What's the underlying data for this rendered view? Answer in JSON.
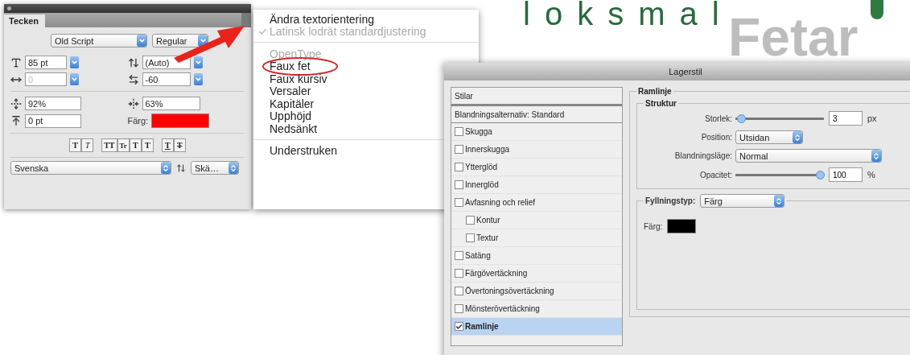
{
  "backdrop": {
    "headline": "loksmal",
    "subheadline": "Fetar"
  },
  "character_panel": {
    "tab": "Tecken",
    "font_family": "Old Script",
    "font_style": "Regular",
    "font_size": "85 pt",
    "leading": "(Auto)",
    "kerning": "0",
    "kerning_disabled": true,
    "tracking": "-60",
    "vertical_scale": "92%",
    "horizontal_scale": "63%",
    "baseline_shift": "0 pt",
    "color_label": "Färg:",
    "style_buttons": [
      {
        "label": "T",
        "kind": "bold"
      },
      {
        "label": "T",
        "kind": "italic"
      },
      {
        "label": "TT",
        "kind": "caps"
      },
      {
        "label": "Tr",
        "kind": "smallcaps"
      },
      {
        "label": "T",
        "kind": "super"
      },
      {
        "label": "T",
        "kind": "sub"
      },
      {
        "label": "T",
        "kind": "underline"
      },
      {
        "label": "T",
        "kind": "strike"
      }
    ],
    "language": "Svenska",
    "antialias": "Skä…"
  },
  "menu": {
    "items": [
      {
        "kind": "item",
        "label": "Ändra textorientering",
        "checked": false,
        "disabled": false,
        "circled": false
      },
      {
        "kind": "item",
        "label": "Latinsk lodrät standardjustering",
        "checked": true,
        "disabled": true,
        "circled": false
      },
      {
        "kind": "separator"
      },
      {
        "kind": "item",
        "label": "OpenType",
        "checked": false,
        "disabled": true,
        "circled": false
      },
      {
        "kind": "item",
        "label": "Faux fet",
        "checked": false,
        "disabled": false,
        "circled": true
      },
      {
        "kind": "item",
        "label": "Faux kursiv",
        "checked": false,
        "disabled": false,
        "circled": false
      },
      {
        "kind": "item",
        "label": "Versaler",
        "checked": false,
        "disabled": false,
        "circled": false
      },
      {
        "kind": "item",
        "label": "Kapitäler",
        "checked": false,
        "disabled": false,
        "circled": false
      },
      {
        "kind": "item",
        "label": "Upphöjd",
        "checked": false,
        "disabled": false,
        "circled": false
      },
      {
        "kind": "item",
        "label": "Nedsänkt",
        "checked": false,
        "disabled": false,
        "circled": false
      },
      {
        "kind": "separator"
      },
      {
        "kind": "item",
        "label": "Understruken",
        "checked": false,
        "disabled": false,
        "circled": false
      }
    ]
  },
  "layer_style": {
    "title": "Lagerstil",
    "styles_header": "Stilar",
    "blending_header": "Blandningsalternativ: Standard",
    "effects": [
      {
        "label": "Skugga",
        "checked": false,
        "selected": false
      },
      {
        "label": "Innerskugga",
        "checked": false,
        "selected": false
      },
      {
        "label": "Ytterglöd",
        "checked": false,
        "selected": false
      },
      {
        "label": "Innerglöd",
        "checked": false,
        "selected": false
      },
      {
        "label": "Avfasning och relief",
        "checked": false,
        "selected": false,
        "children": [
          {
            "label": "Kontur",
            "checked": false,
            "selected": false
          },
          {
            "label": "Textur",
            "checked": false,
            "selected": false
          }
        ]
      },
      {
        "label": "Satäng",
        "checked": false,
        "selected": false
      },
      {
        "label": "Färgövertäckning",
        "checked": false,
        "selected": false
      },
      {
        "label": "Övertoningsövertäckning",
        "checked": false,
        "selected": false
      },
      {
        "label": "Mönsterövertäckning",
        "checked": false,
        "selected": false
      },
      {
        "label": "Ramlinje",
        "checked": true,
        "selected": true
      }
    ],
    "stroke": {
      "group_label": "Ramlinje",
      "structure_label": "Struktur",
      "size": {
        "label": "Storlek:",
        "level": 0.02,
        "value": "3",
        "unit": "px"
      },
      "position": {
        "label": "Position:",
        "value": "Utsidan"
      },
      "blend_mode": {
        "label": "Blandningsläge:",
        "value": "Normal"
      },
      "opacity": {
        "label": "Opacitet:",
        "level": 1,
        "value": "100",
        "unit": "%"
      },
      "fill_type": {
        "label": "Fyllningstyp:",
        "value": "Färg"
      },
      "color_label": "Färg:"
    }
  }
}
